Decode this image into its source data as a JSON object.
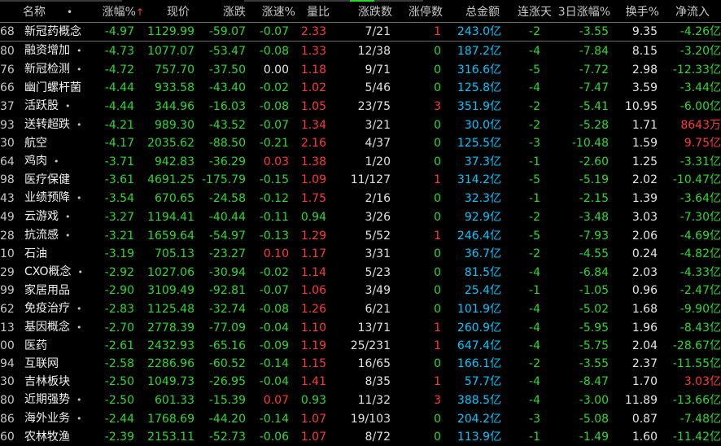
{
  "colors": {
    "up": "#ff3838",
    "down": "#2dd92d",
    "neutral": "#e6e6e6",
    "amount": "#00c8ff",
    "accent_yellow": "#ffff00",
    "bg": "#000000"
  },
  "header": {
    "name": "名称",
    "dot": "•",
    "pct": "涨幅%",
    "sort_mark": "↑",
    "price": "现价",
    "change": "涨跌",
    "speed": "涨速%",
    "vol_ratio": "量比",
    "rise_count": "涨跌数",
    "limit_up": "涨停数",
    "amount": "总金额",
    "streak": "连涨天",
    "pct3d": "3日涨幅%",
    "turnover": "换手%",
    "net_inflow": "净流入"
  },
  "rows": [
    {
      "code": "68",
      "name": "新冠药概念",
      "dot": "",
      "pct": "-4.97",
      "price": "1129.99",
      "change": "-59.07",
      "speed": "-0.07",
      "vol": "2.33",
      "cnt": "7/21",
      "lim": "1",
      "amt": "243.0",
      "amt_unit": "亿",
      "streak": "-2",
      "p3": "-3.55",
      "turn": "9.35",
      "flow": "-4.26",
      "flow_unit": "亿"
    },
    {
      "code": "80",
      "name": "融资增加",
      "dot": "•",
      "pct": "-4.73",
      "price": "1077.07",
      "change": "-53.47",
      "speed": "-0.08",
      "vol": "1.33",
      "cnt": "12/38",
      "lim": "0",
      "amt": "187.2",
      "amt_unit": "亿",
      "streak": "-4",
      "p3": "-7.84",
      "turn": "8.15",
      "flow": "-3.20",
      "flow_unit": "亿"
    },
    {
      "code": "76",
      "name": "新冠检测",
      "dot": "•",
      "pct": "-4.72",
      "price": "757.70",
      "change": "-37.50",
      "speed": "0.00",
      "vol": "1.18",
      "cnt": "9/71",
      "lim": "0",
      "amt": "316.6",
      "amt_unit": "亿",
      "streak": "-5",
      "p3": "-7.72",
      "turn": "2.98",
      "flow": "-12.33",
      "flow_unit": "亿"
    },
    {
      "code": "66",
      "name": "幽门螺杆菌",
      "dot": "",
      "pct": "-4.44",
      "price": "933.58",
      "change": "-43.40",
      "speed": "-0.02",
      "vol": "1.02",
      "cnt": "5/46",
      "lim": "0",
      "amt": "125.8",
      "amt_unit": "亿",
      "streak": "-4",
      "p3": "-7.47",
      "turn": "3.59",
      "flow": "-3.44",
      "flow_unit": "亿"
    },
    {
      "code": "37",
      "name": "活跃股",
      "dot": "•",
      "pct": "-4.44",
      "price": "344.96",
      "change": "-16.03",
      "speed": "-0.08",
      "vol": "1.05",
      "cnt": "23/75",
      "lim": "3",
      "amt": "351.9",
      "amt_unit": "亿",
      "streak": "-2",
      "p3": "-5.41",
      "turn": "10.95",
      "flow": "-6.00",
      "flow_unit": "亿"
    },
    {
      "code": "93",
      "name": "送转超跌",
      "dot": "•",
      "pct": "-4.21",
      "price": "989.30",
      "change": "-43.52",
      "speed": "-0.07",
      "vol": "1.34",
      "cnt": "3/21",
      "lim": "0",
      "amt": "30.0",
      "amt_unit": "亿",
      "streak": "-2",
      "p3": "-5.28",
      "turn": "1.71",
      "flow": "8643",
      "flow_unit": "万"
    },
    {
      "code": "30",
      "name": "航空",
      "dot": "",
      "pct": "-4.17",
      "price": "2035.62",
      "change": "-88.50",
      "speed": "-0.21",
      "vol": "2.16",
      "cnt": "4/37",
      "lim": "0",
      "amt": "125.5",
      "amt_unit": "亿",
      "streak": "-3",
      "p3": "-10.48",
      "turn": "1.59",
      "flow": "9.75",
      "flow_unit": "亿"
    },
    {
      "code": "64",
      "name": "鸡肉",
      "dot": "•",
      "pct": "-3.71",
      "price": "942.83",
      "change": "-36.29",
      "speed": "0.03",
      "vol": "1.38",
      "cnt": "1/20",
      "lim": "0",
      "amt": "37.3",
      "amt_unit": "亿",
      "streak": "-1",
      "p3": "-2.60",
      "turn": "1.25",
      "flow": "-3.31",
      "flow_unit": "亿"
    },
    {
      "code": "98",
      "name": "医疗保健",
      "dot": "",
      "pct": "-3.61",
      "price": "4691.25",
      "change": "-175.79",
      "speed": "-0.15",
      "vol": "1.09",
      "cnt": "11/127",
      "lim": "1",
      "amt": "314.2",
      "amt_unit": "亿",
      "streak": "-5",
      "p3": "-5.19",
      "turn": "2.02",
      "flow": "-10.47",
      "flow_unit": "亿"
    },
    {
      "code": "43",
      "name": "业绩预降",
      "dot": "•",
      "pct": "-3.54",
      "price": "670.65",
      "change": "-24.58",
      "speed": "-0.12",
      "vol": "1.75",
      "cnt": "2/16",
      "lim": "0",
      "amt": "32.3",
      "amt_unit": "亿",
      "streak": "-1",
      "p3": "-2.15",
      "turn": "1.39",
      "flow": "-3.64",
      "flow_unit": "亿"
    },
    {
      "code": "49",
      "name": "云游戏",
      "dot": "•",
      "pct": "-3.27",
      "price": "1194.41",
      "change": "-40.44",
      "speed": "-0.11",
      "vol": "0.94",
      "cnt": "3/26",
      "lim": "0",
      "amt": "92.9",
      "amt_unit": "亿",
      "streak": "-2",
      "p3": "-3.48",
      "turn": "3.03",
      "flow": "-7.30",
      "flow_unit": "亿"
    },
    {
      "code": "28",
      "name": "抗流感",
      "dot": "•",
      "pct": "-3.21",
      "price": "1659.64",
      "change": "-54.97",
      "speed": "-0.13",
      "vol": "1.29",
      "cnt": "5/52",
      "lim": "1",
      "amt": "246.4",
      "amt_unit": "亿",
      "streak": "-5",
      "p3": "-7.93",
      "turn": "2.06",
      "flow": "-4.69",
      "flow_unit": "亿"
    },
    {
      "code": "10",
      "name": "石油",
      "dot": "",
      "pct": "-3.19",
      "price": "705.13",
      "change": "-23.27",
      "speed": "0.10",
      "vol": "1.17",
      "cnt": "3/31",
      "lim": "0",
      "amt": "36.7",
      "amt_unit": "亿",
      "streak": "-2",
      "p3": "-4.55",
      "turn": "0.24",
      "flow": "-4.82",
      "flow_unit": "亿"
    },
    {
      "code": "29",
      "name": "CXO概念",
      "dot": "•",
      "pct": "-2.92",
      "price": "1027.06",
      "change": "-30.94",
      "speed": "-0.02",
      "vol": "1.14",
      "cnt": "5/23",
      "lim": "0",
      "amt": "81.5",
      "amt_unit": "亿",
      "streak": "-4",
      "p3": "-6.84",
      "turn": "2.03",
      "flow": "-4.33",
      "flow_unit": "亿"
    },
    {
      "code": "99",
      "name": "家居用品",
      "dot": "",
      "pct": "-2.90",
      "price": "3109.49",
      "change": "-92.81",
      "speed": "-0.07",
      "vol": "1.06",
      "cnt": "3/49",
      "lim": "0",
      "amt": "25.4",
      "amt_unit": "亿",
      "streak": "-1",
      "p3": "-1.05",
      "turn": "0.96",
      "flow": "-2.47",
      "flow_unit": "亿"
    },
    {
      "code": "62",
      "name": "免疫治疗",
      "dot": "•",
      "pct": "-2.83",
      "price": "1125.48",
      "change": "-32.74",
      "speed": "-0.08",
      "vol": "1.26",
      "cnt": "6/21",
      "lim": "0",
      "amt": "101.9",
      "amt_unit": "亿",
      "streak": "-4",
      "p3": "-5.02",
      "turn": "1.68",
      "flow": "-9.90",
      "flow_unit": "亿"
    },
    {
      "code": "13",
      "name": "基因概念",
      "dot": "•",
      "pct": "-2.70",
      "price": "2778.39",
      "change": "-77.09",
      "speed": "-0.04",
      "vol": "1.10",
      "cnt": "13/71",
      "lim": "1",
      "amt": "260.9",
      "amt_unit": "亿",
      "streak": "-4",
      "p3": "-5.95",
      "turn": "1.96",
      "flow": "-8.43",
      "flow_unit": "亿"
    },
    {
      "code": "00",
      "name": "医药",
      "dot": "",
      "pct": "-2.61",
      "price": "2432.93",
      "change": "-65.16",
      "speed": "-0.09",
      "vol": "1.19",
      "cnt": "25/231",
      "lim": "1",
      "amt": "647.4",
      "amt_unit": "亿",
      "streak": "-4",
      "p3": "-5.75",
      "turn": "2.04",
      "flow": "-28.67",
      "flow_unit": "亿"
    },
    {
      "code": "94",
      "name": "互联网",
      "dot": "",
      "pct": "-2.58",
      "price": "2286.96",
      "change": "-60.52",
      "speed": "-0.14",
      "vol": "1.15",
      "cnt": "16/65",
      "lim": "0",
      "amt": "166.1",
      "amt_unit": "亿",
      "streak": "-2",
      "p3": "-3.55",
      "turn": "2.37",
      "flow": "-11.55",
      "flow_unit": "亿"
    },
    {
      "code": "30",
      "name": "吉林板块",
      "dot": "",
      "pct": "-2.50",
      "price": "1049.73",
      "change": "-26.95",
      "speed": "-0.04",
      "vol": "1.41",
      "cnt": "8/35",
      "lim": "1",
      "amt": "57.7",
      "amt_unit": "亿",
      "streak": "-4",
      "p3": "-8.47",
      "turn": "1.70",
      "flow": "3.03",
      "flow_unit": "亿"
    },
    {
      "code": "80",
      "name": "近期强势",
      "dot": "•",
      "pct": "-2.50",
      "price": "601.33",
      "change": "-15.39",
      "speed": "0.07",
      "vol": "0.93",
      "cnt": "11/32",
      "lim": "3",
      "amt": "388.5",
      "amt_unit": "亿",
      "streak": "-4",
      "p3": "-3.00",
      "turn": "11.89",
      "flow": "-13.66",
      "flow_unit": "亿"
    },
    {
      "code": "86",
      "name": "海外业务",
      "dot": "•",
      "pct": "-2.44",
      "price": "1768.69",
      "change": "-44.20",
      "speed": "-0.14",
      "vol": "1.07",
      "cnt": "19/103",
      "lim": "0",
      "amt": "204.2",
      "amt_unit": "亿",
      "streak": "-3",
      "p3": "-5.08",
      "turn": "0.87",
      "flow": "-7.48",
      "flow_unit": "亿"
    },
    {
      "code": "60",
      "name": "农林牧渔",
      "dot": "",
      "pct": "-2.39",
      "price": "2153.11",
      "change": "-52.73",
      "speed": "-0.06",
      "vol": "1.07",
      "cnt": "8/72",
      "lim": "0",
      "amt": "113.9",
      "amt_unit": "亿",
      "streak": "-1",
      "p3": "-1.49",
      "turn": "1.60",
      "flow": "-11.42",
      "flow_unit": "亿"
    }
  ]
}
